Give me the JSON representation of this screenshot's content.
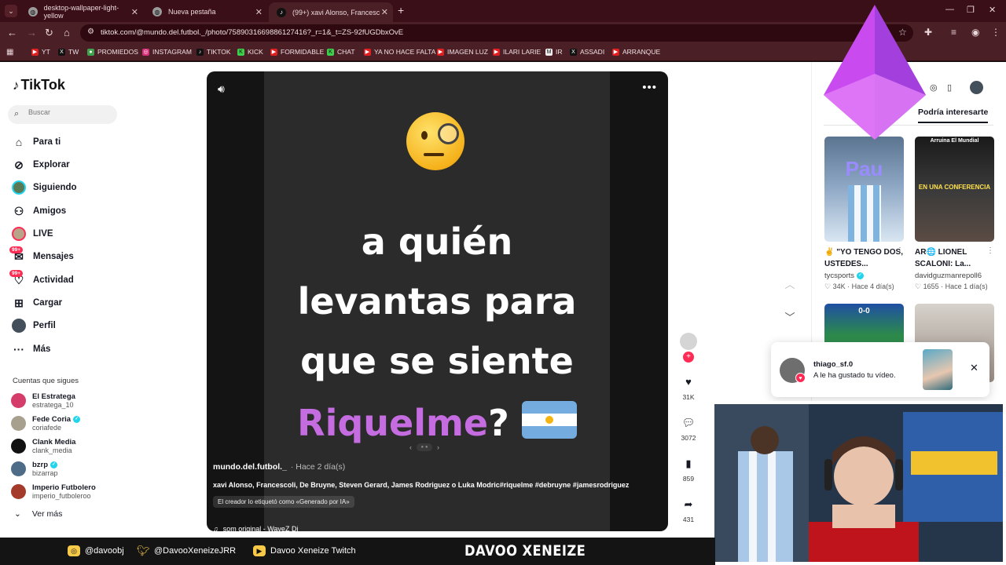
{
  "browser": {
    "tabs": [
      {
        "title": "desktop-wallpaper-light-yellow",
        "active": false
      },
      {
        "title": "Nueva pestaña",
        "active": false
      },
      {
        "title": "(99+) xavi Alonso, Francesc...",
        "active": true
      }
    ],
    "url": "tiktok.com/@mundo.del.futbol._/photo/7589031669886127416?_r=1&_t=ZS-92fUGDbxOvE",
    "bookmarks": [
      "YT",
      "TW",
      "PROMIEDOS",
      "INSTAGRAM",
      "TIKTOK",
      "KICK",
      "FORMIDABLE",
      "CHAT",
      "YA NO HACE FALTA",
      "IMAGEN LUZ",
      "ILARI LARIE",
      "IR",
      "ASSADI",
      "ARRANQUE"
    ]
  },
  "tiktok": {
    "logo": "TikTok",
    "search_placeholder": "Buscar",
    "nav": [
      {
        "label": "Para ti",
        "icon": "home-icon"
      },
      {
        "label": "Explorar",
        "icon": "compass-icon"
      },
      {
        "label": "Siguiendo",
        "icon": "following-icon"
      },
      {
        "label": "Amigos",
        "icon": "friends-icon"
      },
      {
        "label": "LIVE",
        "icon": "live-icon"
      },
      {
        "label": "Mensajes",
        "icon": "messages-icon",
        "badge": "99+"
      },
      {
        "label": "Actividad",
        "icon": "activity-icon",
        "badge": "99+"
      },
      {
        "label": "Cargar",
        "icon": "upload-icon"
      },
      {
        "label": "Perfil",
        "icon": "profile-icon"
      },
      {
        "label": "Más",
        "icon": "more-icon"
      }
    ],
    "following_title": "Cuentas que sigues",
    "accounts": [
      {
        "name": "El Estratega",
        "handle": "estratega_10",
        "verified": false
      },
      {
        "name": "Fede Coria",
        "handle": "coriafede",
        "verified": true
      },
      {
        "name": "Clank Media",
        "handle": "clank_media",
        "verified": false
      },
      {
        "name": "bzrp",
        "handle": "bizarrap",
        "verified": true
      },
      {
        "name": "Imperio Futbolero",
        "handle": "imperio_futboleroo",
        "verified": false
      }
    ],
    "see_more": "Ver más"
  },
  "video": {
    "line1": "a quién",
    "line2": "levantas para",
    "line3": "que se siente",
    "highlight": "Riquelme",
    "question_mark": "?",
    "author": "mundo.del.futbol._",
    "time": "· Hace 2 día(s)",
    "description": "xavi Alonso, Francescoli, De Bruyne, Steven Gerard, James Rodriguez o Luka Modric#riquelme #debruyne #jamesrodriguez",
    "ai_label": "El creador lo etiquetó como «Generado por IA»",
    "music": "som original - WaveZ Dj"
  },
  "actions": {
    "likes": "31K",
    "comments": "3072",
    "saves": "859",
    "shares": "431"
  },
  "right": {
    "tab": "Podría interesarte",
    "cards": [
      {
        "title": "✌️ \"YO TENGO DOS, USTEDES...",
        "user": "tycsports",
        "verified": true,
        "likes": "34K",
        "time": "Hace 4 día(s)",
        "overlay": "Pau"
      },
      {
        "title": "AR🌐 LIONEL SCALONI: La...",
        "user": "davidguzmanrepoll6",
        "verified": false,
        "likes": "1655",
        "time": "Hace 1 día(s)",
        "overlay_top": "Arruina El Mundial",
        "overlay_mid": "EN UNA CONFERENCIA"
      }
    ],
    "score": "0-0"
  },
  "notification": {
    "user": "thiago_sf.0",
    "text": "A le ha gustado tu vídeo."
  },
  "stream": {
    "instagram": "@davoobj",
    "twitter": "@DavooXeneizeJRR",
    "youtube": "Davoo Xeneize Twitch",
    "title": "DAVOO XENEIZE"
  }
}
